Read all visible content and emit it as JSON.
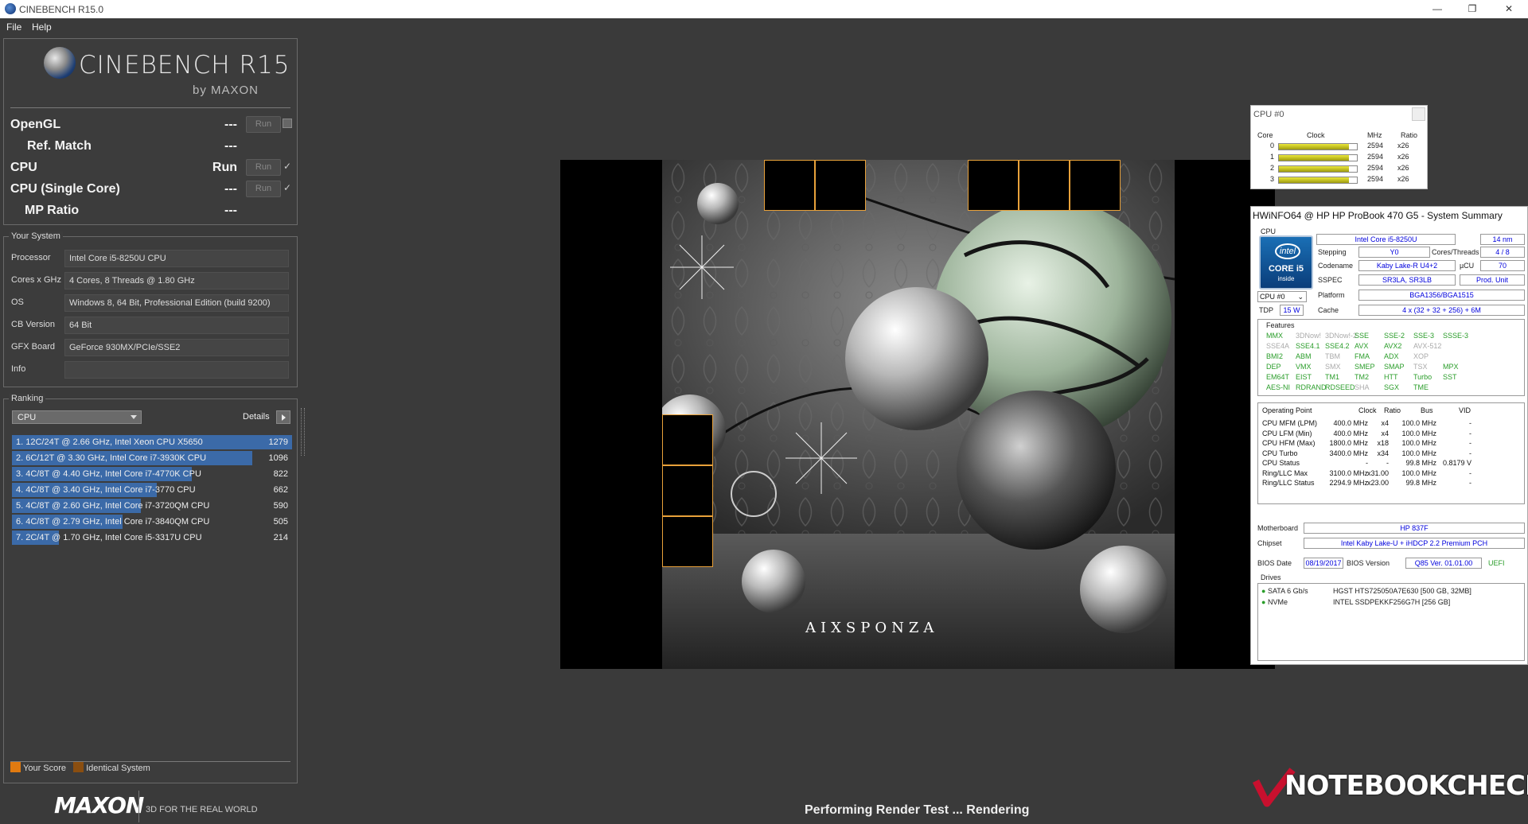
{
  "window": {
    "title": "CINEBENCH R15.0",
    "minimize": "—",
    "restore": "❐",
    "close": "✕"
  },
  "menu": {
    "file": "File",
    "help": "Help"
  },
  "logo": {
    "name": "CINEBENCH R15",
    "by": "by MAXON"
  },
  "benchmarks": {
    "opengl": {
      "label": "OpenGL",
      "score": "---",
      "run": "Run"
    },
    "ref_match": {
      "label": "Ref. Match",
      "score": "---"
    },
    "cpu": {
      "label": "CPU",
      "score": "Run",
      "run": "Run"
    },
    "cpu_single": {
      "label": "CPU (Single Core)",
      "score": "---",
      "run": "Run"
    },
    "mp_ratio": {
      "label": "MP Ratio",
      "score": "---"
    }
  },
  "your_system": {
    "title": "Your System",
    "rows": [
      {
        "label": "Processor",
        "value": "Intel Core i5-8250U CPU"
      },
      {
        "label": "Cores x GHz",
        "value": "4 Cores, 8 Threads @ 1.80 GHz"
      },
      {
        "label": "OS",
        "value": "Windows 8, 64 Bit, Professional Edition (build 9200)"
      },
      {
        "label": "CB Version",
        "value": "64 Bit"
      },
      {
        "label": "GFX Board",
        "value": "GeForce 930MX/PCIe/SSE2"
      },
      {
        "label": "Info",
        "value": ""
      }
    ]
  },
  "ranking": {
    "title": "Ranking",
    "dropdown": "CPU",
    "details": "Details",
    "rows": [
      {
        "text": "1. 12C/24T @ 2.66 GHz, Intel Xeon CPU X5650",
        "score": "1279",
        "value": 1279
      },
      {
        "text": "2. 6C/12T @ 3.30 GHz,  Intel Core i7-3930K CPU",
        "score": "1096",
        "value": 1096
      },
      {
        "text": "3. 4C/8T @ 4.40 GHz, Intel Core i7-4770K CPU",
        "score": "822",
        "value": 822
      },
      {
        "text": "4. 4C/8T @ 3.40 GHz,  Intel Core i7-3770 CPU",
        "score": "662",
        "value": 662
      },
      {
        "text": "5. 4C/8T @ 2.60 GHz, Intel Core i7-3720QM CPU",
        "score": "590",
        "value": 590
      },
      {
        "text": "6. 4C/8T @ 2.79 GHz,  Intel Core i7-3840QM CPU",
        "score": "505",
        "value": 505
      },
      {
        "text": "7. 2C/4T @ 1.70 GHz,  Intel Core i5-3317U CPU",
        "score": "214",
        "value": 214
      }
    ],
    "legend_your_score": "Your Score",
    "legend_identical": "Identical System"
  },
  "footer": {
    "maxon": "MAXON",
    "tagline": "3D FOR THE REAL WORLD",
    "status": "Performing Render Test ... Rendering"
  },
  "render": {
    "brand": "AIXSPONZA"
  },
  "cpu0_window": {
    "title": "CPU #0",
    "headers": [
      "Core",
      "Clock",
      "MHz",
      "Ratio"
    ],
    "cores": [
      {
        "core": "0",
        "mhz": "2594",
        "ratio": "x26",
        "load": 0.9
      },
      {
        "core": "1",
        "mhz": "2594",
        "ratio": "x26",
        "load": 0.9
      },
      {
        "core": "2",
        "mhz": "2594",
        "ratio": "x26",
        "load": 0.9
      },
      {
        "core": "3",
        "mhz": "2594",
        "ratio": "x26",
        "load": 0.9
      }
    ]
  },
  "hwinfo": {
    "title": "HWiNFO64 @ HP HP ProBook 470 G5 - System Summary",
    "cpu_section": "CPU",
    "cpu_name": "Intel Core i5-8250U",
    "nm": "14 nm",
    "stepping_label": "Stepping",
    "stepping": "Y0",
    "cores_threads_label": "Cores/Threads",
    "cores_threads": "4 / 8",
    "codename_label": "Codename",
    "codename": "Kaby Lake-R U4+2",
    "ucu_label": "µCU",
    "ucu": "70",
    "sspec_label": "SSPEC",
    "sspec": "SR3LA, SR3LB",
    "prod_unit": "Prod. Unit",
    "cpu_select": "CPU #0",
    "platform_label": "Platform",
    "platform": "BGA1356/BGA1515",
    "tdp_label": "TDP",
    "tdp": "15 W",
    "cache_label": "Cache",
    "cache": "4 x (32 + 32 + 256) + 6M",
    "intel_badge": {
      "brand": "intel",
      "line": "CORE i5",
      "inside": "inside"
    },
    "features_label": "Features",
    "features": [
      [
        {
          "t": "MMX",
          "on": true
        },
        {
          "t": "3DNow!",
          "on": false
        },
        {
          "t": "3DNow!-2",
          "on": false
        },
        {
          "t": "SSE",
          "on": true
        },
        {
          "t": "SSE-2",
          "on": true
        },
        {
          "t": "SSE-3",
          "on": true
        },
        {
          "t": "SSSE-3",
          "on": true
        }
      ],
      [
        {
          "t": "SSE4A",
          "on": false
        },
        {
          "t": "SSE4.1",
          "on": true
        },
        {
          "t": "SSE4.2",
          "on": true
        },
        {
          "t": "AVX",
          "on": true
        },
        {
          "t": "AVX2",
          "on": true
        },
        {
          "t": "AVX-512",
          "on": false
        }
      ],
      [
        {
          "t": "BMI2",
          "on": true
        },
        {
          "t": "ABM",
          "on": true
        },
        {
          "t": "TBM",
          "on": false
        },
        {
          "t": "FMA",
          "on": true
        },
        {
          "t": "ADX",
          "on": true
        },
        {
          "t": "XOP",
          "on": false
        }
      ],
      [
        {
          "t": "DEP",
          "on": true
        },
        {
          "t": "VMX",
          "on": true
        },
        {
          "t": "SMX",
          "on": false
        },
        {
          "t": "SMEP",
          "on": true
        },
        {
          "t": "SMAP",
          "on": true
        },
        {
          "t": "TSX",
          "on": false
        },
        {
          "t": "MPX",
          "on": true
        }
      ],
      [
        {
          "t": "EM64T",
          "on": true
        },
        {
          "t": "EIST",
          "on": true
        },
        {
          "t": "TM1",
          "on": true
        },
        {
          "t": "TM2",
          "on": true
        },
        {
          "t": "HTT",
          "on": true
        },
        {
          "t": "Turbo",
          "on": true
        },
        {
          "t": "SST",
          "on": true
        }
      ],
      [
        {
          "t": "AES-NI",
          "on": true
        },
        {
          "t": "RDRAND",
          "on": true
        },
        {
          "t": "RDSEED",
          "on": true
        },
        {
          "t": "SHA",
          "on": false
        },
        {
          "t": "SGX",
          "on": true
        },
        {
          "t": "TME",
          "on": true
        }
      ]
    ],
    "op_headers": [
      "Operating Point",
      "Clock",
      "Ratio",
      "Bus",
      "VID"
    ],
    "op_rows": [
      [
        "CPU MFM (LPM)",
        "400.0 MHz",
        "x4",
        "100.0 MHz",
        "-"
      ],
      [
        "CPU LFM (Min)",
        "400.0 MHz",
        "x4",
        "100.0 MHz",
        "-"
      ],
      [
        "CPU HFM (Max)",
        "1800.0 MHz",
        "x18",
        "100.0 MHz",
        "-"
      ],
      [
        "CPU Turbo",
        "3400.0 MHz",
        "x34",
        "100.0 MHz",
        "-"
      ],
      [
        "CPU Status",
        "-",
        "-",
        "99.8 MHz",
        "0.8179 V"
      ],
      [
        "Ring/LLC Max",
        "3100.0 MHz",
        "x31.00",
        "100.0 MHz",
        "-"
      ],
      [
        "Ring/LLC Status",
        "2294.9 MHz",
        "x23.00",
        "99.8 MHz",
        "-"
      ]
    ],
    "motherboard_label": "Motherboard",
    "motherboard": "HP 837F",
    "chipset_label": "Chipset",
    "chipset": "Intel Kaby Lake-U + iHDCP 2.2 Premium PCH",
    "bios_date_label": "BIOS Date",
    "bios_date": "08/19/2017",
    "bios_version_label": "BIOS Version",
    "bios_version": "Q85 Ver. 01.01.00",
    "uefi": "UEFI",
    "drives_label": "Drives",
    "drives": [
      {
        "type": "SATA 6 Gb/s",
        "name": "HGST HTS725050A7E630 [500 GB, 32MB]"
      },
      {
        "type": "NVMe",
        "name": "INTEL SSDPEKKF256G7H [256 GB]"
      }
    ]
  },
  "watermark": "NOTEBOOKCHECK",
  "colors": {
    "your_score": "#e07a10",
    "identical_system": "#8a4e10",
    "rank_bar": "#3b6aa8",
    "bucket_border": "#e8a13a"
  }
}
